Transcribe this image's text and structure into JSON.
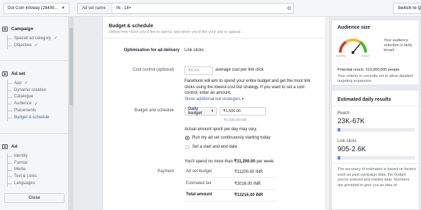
{
  "topbar": {
    "account": "Dot Com Infoway (28400...",
    "adset_name_label": "Ad set name",
    "adset_name_value": "IN - 18+",
    "switch_button": "Switch to Q"
  },
  "leftnav": {
    "campaign": {
      "title": "Campaign",
      "items": [
        {
          "label": "Special ad category",
          "done": true
        },
        {
          "label": "Objective",
          "done": true
        }
      ]
    },
    "adset": {
      "title": "Ad set",
      "items": [
        {
          "label": "App",
          "done": true
        },
        {
          "label": "Dynamic creative",
          "done": false
        },
        {
          "label": "Catalogue",
          "done": false
        },
        {
          "label": "Audience",
          "done": true
        },
        {
          "label": "Placements",
          "done": false
        },
        {
          "label": "Budget & schedule",
          "done": false,
          "active": true
        }
      ]
    },
    "ad": {
      "title": "Ad",
      "items": [
        {
          "label": "Identity"
        },
        {
          "label": "Format"
        },
        {
          "label": "Media"
        },
        {
          "label": "Text & Links"
        },
        {
          "label": "Languages"
        }
      ]
    },
    "close_button": "Close",
    "check_glyph": "✓"
  },
  "main": {
    "title": "Budget & schedule",
    "description": "Define how much you'd like to spend, and when you'd like your ads to appear.",
    "optimisation": {
      "label": "Optimisation for ad delivery",
      "value": "Link clicks"
    },
    "cost_control": {
      "label": "Cost control (optional)",
      "placeholder": "₹X.XX",
      "suffix": "average cost per link click",
      "help": "Facebook will aim to spend your entire budget and get the most link clicks using the lowest-cost bid strategy. If you want to set a cost control, enter an amount.",
      "link": "Show additional bid strategies ▾"
    },
    "budget": {
      "label": "Budget and schedule",
      "type": "Daily budget",
      "amount": "₹1,600.00",
      "amount_note": "₹1,600.00 INR",
      "variance_note": "Actual amount spent per day may vary.",
      "options": [
        {
          "label": "Run my ad set continuously starting today",
          "selected": true
        },
        {
          "label": "Set a start and end date",
          "selected": false
        }
      ],
      "weekly_note_prefix": "You'll spend no more than ",
      "weekly_amount": "₹11,200.00",
      "weekly_note_suffix": " per week."
    },
    "payment": {
      "label": "Payment",
      "rows": [
        {
          "name": "Ad set budget",
          "value": "₹11200.00 INR"
        },
        {
          "name": "Estimated tax",
          "value": "₹2016.00 INR"
        },
        {
          "name": "Total amount",
          "value": "₹13216.00 INR"
        }
      ]
    }
  },
  "right": {
    "audience": {
      "title": "Audience size",
      "summary": "Your audience selection is fairly broad.",
      "gauge_left": "Specific",
      "gauge_right": "Broad",
      "potential_reach": "Potential reach: 310,000,000 people",
      "criteria": "Your criteria is currently set to allow detailed targeting expansion."
    },
    "estimates": {
      "title": "Estimated daily results",
      "reach_label": "Reach",
      "reach_value": "23K-67K",
      "reach_fill": 0.04,
      "clicks_label": "Link clicks",
      "clicks_value": "905-2.6K",
      "clicks_fill": 0.04,
      "note": "The accuracy of estimates is based on factors such as past campaign data, the budget you've entered and market data. Numbers are provided to give you an idea of"
    }
  }
}
